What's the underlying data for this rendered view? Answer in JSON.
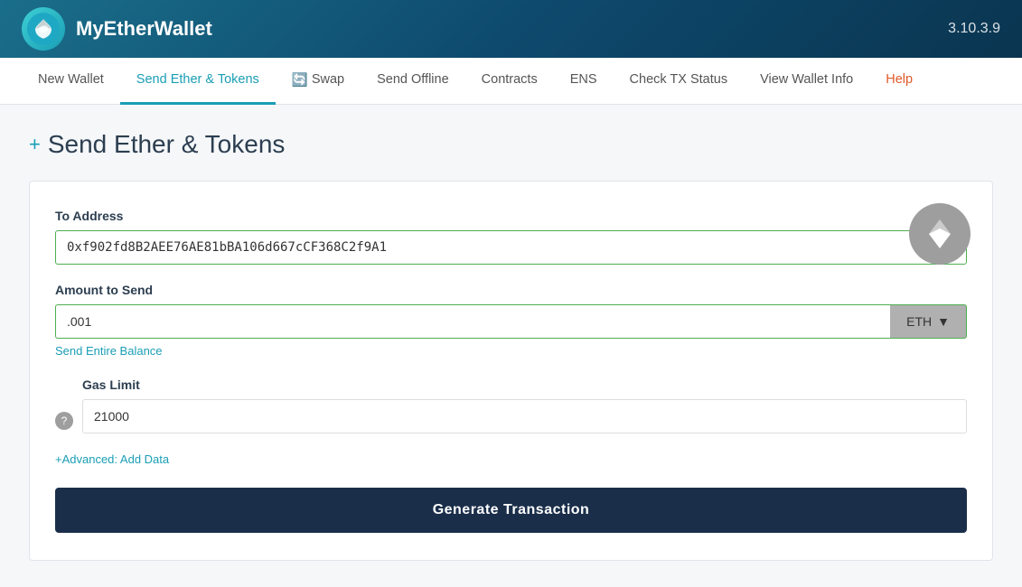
{
  "app": {
    "name": "MyEtherWallet",
    "version": "3.10.3.9"
  },
  "nav": {
    "items": [
      {
        "id": "new-wallet",
        "label": "New Wallet",
        "active": false
      },
      {
        "id": "send-ether-tokens",
        "label": "Send Ether & Tokens",
        "active": true
      },
      {
        "id": "swap",
        "label": "Swap",
        "active": false,
        "hasIcon": true
      },
      {
        "id": "send-offline",
        "label": "Send Offline",
        "active": false
      },
      {
        "id": "contracts",
        "label": "Contracts",
        "active": false
      },
      {
        "id": "ens",
        "label": "ENS",
        "active": false
      },
      {
        "id": "check-tx-status",
        "label": "Check TX Status",
        "active": false
      },
      {
        "id": "view-wallet-info",
        "label": "View Wallet Info",
        "active": false
      },
      {
        "id": "help",
        "label": "Help",
        "active": false,
        "isHelp": true
      }
    ]
  },
  "page": {
    "title": "Send Ether & Tokens",
    "plus_symbol": "+"
  },
  "form": {
    "to_address_label": "To Address",
    "to_address_value": "0xf902fd8B2AEE76AE81bBA106d667cCF368C2f9A1",
    "amount_label": "Amount to Send",
    "amount_value": ".001",
    "currency": "ETH",
    "send_entire_balance": "Send Entire Balance",
    "gas_limit_label": "Gas Limit",
    "gas_limit_value": "21000",
    "advanced_link": "+Advanced: Add Data",
    "generate_btn": "Generate Transaction"
  }
}
